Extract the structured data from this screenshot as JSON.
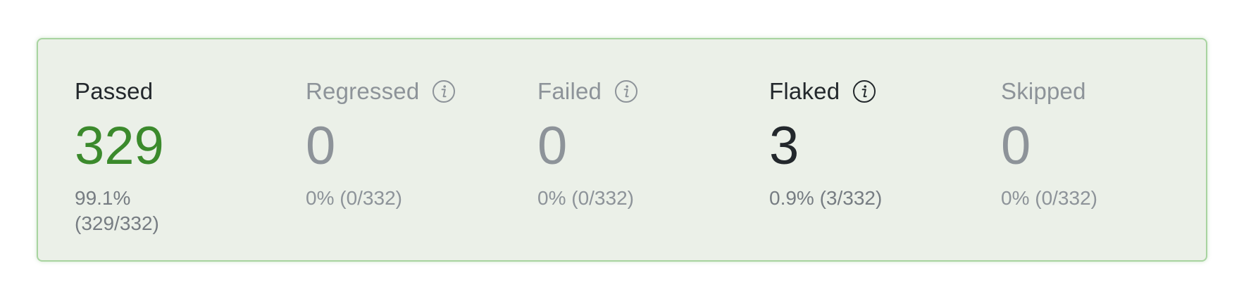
{
  "summary": {
    "passed": {
      "label": "Passed",
      "value": "329",
      "percent": "99.1%",
      "ratio": "(329/332)",
      "value_color": "#3b8a2c"
    },
    "regressed": {
      "label": "Regressed",
      "value": "0",
      "detail": "0% (0/332)",
      "icon": "info-icon"
    },
    "failed": {
      "label": "Failed",
      "value": "0",
      "detail": "0% (0/332)",
      "icon": "info-icon"
    },
    "flaked": {
      "label": "Flaked",
      "value": "3",
      "detail": "0.9% (3/332)",
      "icon": "info-icon"
    },
    "skipped": {
      "label": "Skipped",
      "value": "0",
      "detail": "0% (0/332)"
    }
  },
  "colors": {
    "card_background": "#ebf0e8",
    "card_border": "#a8d4a0",
    "passed_green": "#3b8a2c",
    "muted_text": "#8d9399",
    "dark_text": "#23282c"
  }
}
